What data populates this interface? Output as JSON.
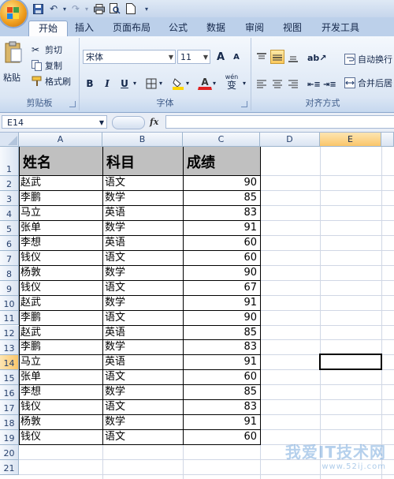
{
  "quick_access": {
    "more": "▾"
  },
  "tabs": [
    "开始",
    "插入",
    "页面布局",
    "公式",
    "数据",
    "审阅",
    "视图",
    "开发工具"
  ],
  "ribbon": {
    "clipboard": {
      "paste": "粘贴",
      "cut": "剪切",
      "copy": "复制",
      "format_painter": "格式刷",
      "label": "剪贴板"
    },
    "font": {
      "name": "宋体",
      "size": "11",
      "grow": "A",
      "shrink": "A",
      "bold": "B",
      "italic": "I",
      "underline": "U",
      "wen": "wén",
      "wen_sub": "变",
      "label": "字体"
    },
    "alignment": {
      "wrap": "自动换行",
      "merge": "合并后居",
      "label": "对齐方式"
    }
  },
  "formula_bar": {
    "name_box": "E14",
    "fx": "fx",
    "value": ""
  },
  "columns": [
    "A",
    "B",
    "C",
    "D",
    "E"
  ],
  "rows": [
    "1",
    "2",
    "3",
    "4",
    "5",
    "6",
    "7",
    "8",
    "9",
    "10",
    "11",
    "12",
    "13",
    "14",
    "15",
    "16",
    "17",
    "18",
    "19",
    "20",
    "21"
  ],
  "table": {
    "headers": [
      "姓名",
      "科目",
      "成绩"
    ],
    "rows": [
      [
        "赵武",
        "语文",
        "90"
      ],
      [
        "李鹏",
        "数学",
        "85"
      ],
      [
        "马立",
        "英语",
        "83"
      ],
      [
        "张单",
        "数学",
        "91"
      ],
      [
        "李想",
        "英语",
        "60"
      ],
      [
        "钱仪",
        "语文",
        "60"
      ],
      [
        "杨敦",
        "数学",
        "90"
      ],
      [
        "钱仪",
        "语文",
        "67"
      ],
      [
        "赵武",
        "数学",
        "91"
      ],
      [
        "李鹏",
        "语文",
        "90"
      ],
      [
        "赵武",
        "英语",
        "85"
      ],
      [
        "李鹏",
        "数学",
        "83"
      ],
      [
        "马立",
        "英语",
        "91"
      ],
      [
        "张单",
        "语文",
        "60"
      ],
      [
        "李想",
        "数学",
        "85"
      ],
      [
        "钱仪",
        "语文",
        "83"
      ],
      [
        "杨敦",
        "数学",
        "91"
      ],
      [
        "钱仪",
        "语文",
        "60"
      ]
    ]
  },
  "watermark": {
    "text": "我爱IT技术网",
    "url": "www.52ij.com"
  },
  "colors": {
    "accent": "#fbc95c",
    "header_fill": "#c0c0c0",
    "ribbon": "#dbe6f4"
  }
}
